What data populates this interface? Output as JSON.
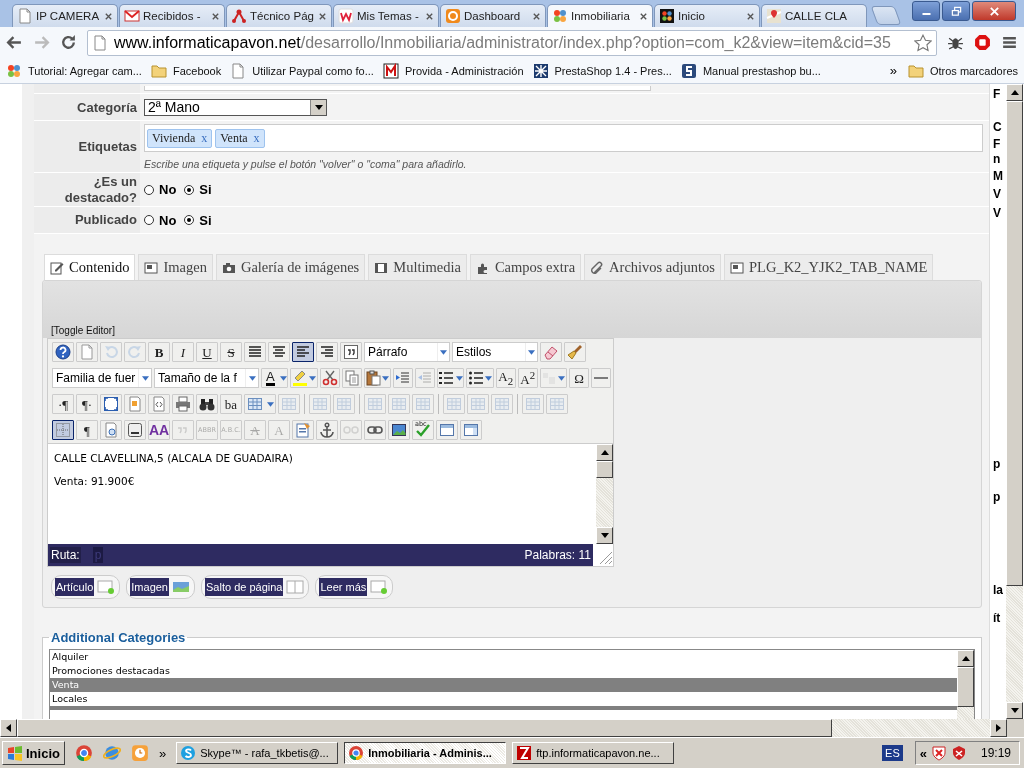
{
  "browser": {
    "tabs": [
      {
        "title": "IP CAMERA",
        "selected": false
      },
      {
        "title": "Recibidos -",
        "selected": false
      },
      {
        "title": "Técnico Pág",
        "selected": false
      },
      {
        "title": "Mis Temas -",
        "selected": false
      },
      {
        "title": "Dashboard",
        "selected": false
      },
      {
        "title": "Inmobiliaria",
        "selected": true
      },
      {
        "title": "Inicio",
        "selected": false
      },
      {
        "title": "CALLE CLA",
        "selected": false
      }
    ],
    "address": {
      "domain": "www.informaticapavon.net",
      "path": "/desarrollo/Inmobiliaria/administrator/index.php?option=com_k2&view=item&cid=35"
    },
    "bookmarks": [
      {
        "label": "Tutorial: Agregar cam..."
      },
      {
        "label": "Facebook"
      },
      {
        "label": "Utilizar Paypal como fo..."
      },
      {
        "label": "Provida - Administración"
      },
      {
        "label": "PrestaShop 1.4 - Pres..."
      },
      {
        "label": "Manual prestashop bu..."
      }
    ],
    "bookmarks_more": "»",
    "other_bookmarks": "Otros marcadores"
  },
  "form": {
    "category": {
      "label": "Categoría",
      "value": "2ª Mano"
    },
    "tags": {
      "label": "Etiquetas",
      "items": [
        {
          "label": "Vivienda",
          "remove": "x"
        },
        {
          "label": "Venta",
          "remove": "x"
        }
      ],
      "hint": "Escribe una etiqueta y pulse el botón \"volver\" o \"coma\" para añadirlo."
    },
    "radios": [
      {
        "label": "¿Es un destacado?",
        "options": [
          {
            "label": "No",
            "selected": false
          },
          {
            "label": "Si",
            "selected": true
          }
        ]
      },
      {
        "label": "Publicado",
        "options": [
          {
            "label": "No",
            "selected": false
          },
          {
            "label": "Si",
            "selected": true
          }
        ]
      }
    ]
  },
  "editor_tabs": [
    {
      "label": "Contenido",
      "selected": true
    },
    {
      "label": "Imagen",
      "selected": false
    },
    {
      "label": "Galería de imágenes",
      "selected": false
    },
    {
      "label": "Multimedia",
      "selected": false
    },
    {
      "label": "Campos extra",
      "selected": false
    },
    {
      "label": "Archivos adjuntos",
      "selected": false
    },
    {
      "label": "PLG_K2_YJK2_TAB_NAME",
      "selected": false
    }
  ],
  "editor": {
    "toggle": "[Toggle Editor]",
    "toolbar": [
      [
        {
          "kind": "button",
          "selected": false,
          "disabled": false
        },
        {
          "kind": "button",
          "selected": false,
          "disabled": false
        },
        {
          "kind": "button",
          "selected": false,
          "disabled": true
        },
        {
          "kind": "button",
          "selected": false,
          "disabled": true
        },
        {
          "kind": "button",
          "label": "B",
          "selected": false,
          "disabled": false
        },
        {
          "kind": "button",
          "label": "I",
          "selected": false,
          "disabled": false
        },
        {
          "kind": "button",
          "label": "U",
          "selected": false,
          "disabled": false
        },
        {
          "kind": "button",
          "label": "S",
          "selected": false,
          "disabled": false
        },
        {
          "kind": "button",
          "selected": false,
          "disabled": false
        },
        {
          "kind": "button",
          "selected": false,
          "disabled": false
        },
        {
          "kind": "button",
          "selected": true,
          "disabled": false
        },
        {
          "kind": "button",
          "selected": false,
          "disabled": false
        },
        {
          "kind": "button",
          "selected": false,
          "disabled": false
        },
        {
          "kind": "select",
          "value": "Párrafo"
        },
        {
          "kind": "select",
          "value": "Estilos"
        },
        {
          "kind": "button",
          "selected": false,
          "disabled": false
        },
        {
          "kind": "button",
          "selected": false,
          "disabled": false
        }
      ],
      [
        {
          "kind": "select",
          "value": "Familia de fuer"
        },
        {
          "kind": "select",
          "value": "Tamaño de la f"
        },
        {
          "kind": "split",
          "label": "A",
          "selected": false,
          "disabled": false
        },
        {
          "kind": "split",
          "selected": false,
          "disabled": false
        },
        {
          "kind": "button",
          "selected": false,
          "disabled": false
        },
        {
          "kind": "button",
          "selected": false,
          "disabled": false
        },
        {
          "kind": "split",
          "selected": false,
          "disabled": false
        },
        {
          "kind": "button",
          "selected": false,
          "disabled": false
        },
        {
          "kind": "button",
          "selected": false,
          "disabled": true
        },
        {
          "kind": "split",
          "selected": false,
          "disabled": false
        },
        {
          "kind": "split",
          "selected": false,
          "disabled": false
        },
        {
          "kind": "button",
          "label": "A$_{2}$",
          "selected": false,
          "disabled": false
        },
        {
          "kind": "button",
          "label": "A$^{2}$",
          "selected": false,
          "disabled": false
        },
        {
          "kind": "split",
          "selected": false,
          "disabled": true
        },
        {
          "kind": "button",
          "label": "Ω",
          "selected": false,
          "disabled": false
        },
        {
          "kind": "button",
          "selected": false,
          "disabled": false
        }
      ],
      [
        {
          "kind": "button",
          "label": "·¶",
          "selected": false,
          "disabled": false
        },
        {
          "kind": "button",
          "label": "¶·",
          "selected": false,
          "disabled": false
        },
        {
          "kind": "button",
          "selected": false,
          "disabled": false
        },
        {
          "kind": "button",
          "selected": false,
          "disabled": false
        },
        {
          "kind": "button",
          "selected": false,
          "disabled": false
        },
        {
          "kind": "button",
          "selected": false,
          "disabled": false
        },
        {
          "kind": "button",
          "selected": false,
          "disabled": false
        },
        {
          "kind": "button",
          "label": "ba",
          "selected": false,
          "disabled": false
        },
        {
          "kind": "split",
          "selected": false,
          "disabled": false
        },
        {
          "kind": "button",
          "selected": false,
          "disabled": true
        },
        {
          "kind": "sep"
        },
        {
          "kind": "button",
          "selected": false,
          "disabled": true
        },
        {
          "kind": "button",
          "selected": false,
          "disabled": true
        },
        {
          "kind": "sep"
        },
        {
          "kind": "button",
          "selected": false,
          "disabled": true
        },
        {
          "kind": "button",
          "selected": false,
          "disabled": true
        },
        {
          "kind": "button",
          "selected": false,
          "disabled": true
        },
        {
          "kind": "sep"
        },
        {
          "kind": "button",
          "selected": false,
          "disabled": true
        },
        {
          "kind": "button",
          "selected": false,
          "disabled": true
        },
        {
          "kind": "button",
          "selected": false,
          "disabled": true
        },
        {
          "kind": "sep"
        },
        {
          "kind": "button",
          "selected": false,
          "disabled": true
        },
        {
          "kind": "button",
          "selected": false,
          "disabled": true
        }
      ],
      [
        {
          "kind": "button",
          "selected": true,
          "disabled": false
        },
        {
          "kind": "button",
          "label": "¶",
          "selected": false,
          "disabled": false
        },
        {
          "kind": "button",
          "selected": false,
          "disabled": false
        },
        {
          "kind": "button",
          "selected": false,
          "disabled": false
        },
        {
          "kind": "button",
          "label": "AA",
          "selected": false,
          "disabled": false
        },
        {
          "kind": "button",
          "selected": false,
          "disabled": true
        },
        {
          "kind": "button",
          "label": "ABBR",
          "selected": false,
          "disabled": true
        },
        {
          "kind": "button",
          "label": "A.B.C.",
          "selected": false,
          "disabled": true
        },
        {
          "kind": "button",
          "label": "A",
          "selected": false,
          "disabled": true
        },
        {
          "kind": "button",
          "label": "A",
          "selected": false,
          "disabled": true
        },
        {
          "kind": "button",
          "selected": false,
          "disabled": false
        },
        {
          "kind": "button",
          "selected": false,
          "disabled": false
        },
        {
          "kind": "button",
          "selected": false,
          "disabled": true
        },
        {
          "kind": "button",
          "selected": false,
          "disabled": false
        },
        {
          "kind": "button",
          "selected": false,
          "disabled": false
        },
        {
          "kind": "button",
          "label": "abc",
          "disabled": false
        },
        {
          "kind": "button",
          "selected": false,
          "disabled": false
        },
        {
          "kind": "button",
          "selected": false,
          "disabled": false
        }
      ]
    ],
    "content": [
      "CALLE CLAVELLINA,5 (ALCALA DE GUADAIRA)",
      "Venta: 91.900€"
    ],
    "path_label": "Ruta:",
    "path": "p",
    "word_count": "Palabras: 11",
    "buttons": [
      "Artículo",
      "Imagen",
      "Salto de página",
      "Leer más"
    ]
  },
  "additional_categories": {
    "title": "Additional Categories",
    "items": [
      {
        "label": "Alquiler",
        "selected": false
      },
      {
        "label": "Promociones destacadas",
        "selected": false
      },
      {
        "label": "Venta",
        "selected": true
      },
      {
        "label": "Locales",
        "selected": false
      }
    ]
  },
  "side_fragments": [
    "F",
    "C",
    "F",
    "n",
    "M",
    "V",
    "V",
    "p",
    "p",
    "la",
    "ít"
  ],
  "taskbar": {
    "start": "Inicio",
    "more": "»",
    "tasks": [
      {
        "title": "Skype™ - rafa_tkbetis@...",
        "selected": false
      },
      {
        "title": "Inmobiliaria - Adminis...",
        "selected": true
      },
      {
        "title": "ftp.informaticapavon.ne...",
        "selected": false
      }
    ],
    "language": "ES",
    "tray_more": "«",
    "clock": "19:19"
  }
}
